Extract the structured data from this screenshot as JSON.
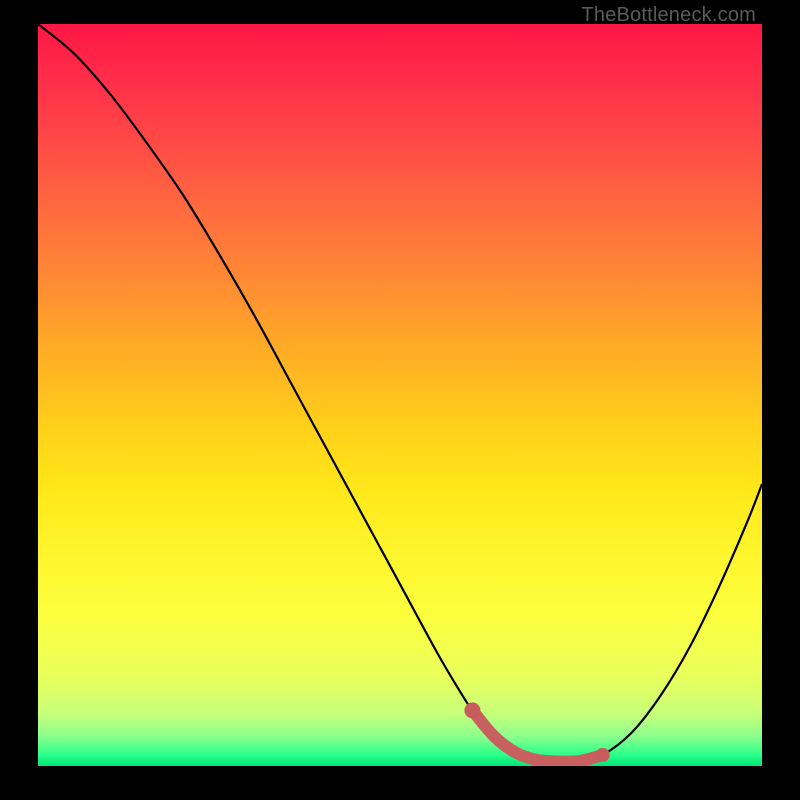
{
  "watermark": "TheBottleneck.com",
  "colors": {
    "background": "#000000",
    "curve": "#000000",
    "seg_a": "#c96060",
    "seg_b": "#cc5d5d",
    "marker": "#c85c5c"
  },
  "chart_data": {
    "type": "line",
    "title": "",
    "xlabel": "",
    "ylabel": "",
    "xlim": [
      0,
      100
    ],
    "ylim": [
      0,
      100
    ],
    "series": [
      {
        "name": "bottleneck-curve",
        "x": [
          0,
          5,
          10,
          15,
          20,
          25,
          30,
          35,
          40,
          45,
          50,
          55,
          58,
          60,
          63,
          66,
          69,
          72,
          75,
          78,
          82,
          86,
          90,
          94,
          98,
          100
        ],
        "y": [
          100,
          96,
          90.5,
          84,
          77,
          69,
          60.5,
          51.5,
          42.5,
          33.5,
          24.5,
          15.5,
          10.5,
          7.5,
          4,
          1.8,
          0.8,
          0.6,
          0.7,
          1.5,
          4.5,
          9.5,
          16,
          24,
          33,
          38
        ]
      },
      {
        "name": "highlight-segment",
        "x": [
          60,
          63,
          66,
          69,
          72,
          75,
          78
        ],
        "y": [
          7.5,
          4,
          1.8,
          0.8,
          0.6,
          0.7,
          1.5
        ]
      }
    ],
    "markers": [
      {
        "name": "left-elbow",
        "x": 60,
        "y": 7.5
      },
      {
        "name": "right-marker",
        "x": 78,
        "y": 1.5
      }
    ]
  }
}
